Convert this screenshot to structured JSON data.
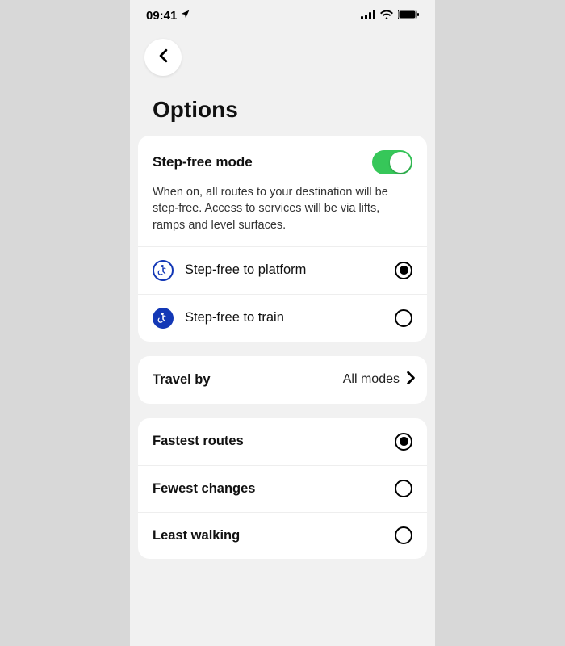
{
  "status": {
    "time": "09:41"
  },
  "page": {
    "title": "Options"
  },
  "stepfree": {
    "title": "Step-free mode",
    "description": "When on, all routes to your destination will be step-free. Access to services will be via lifts, ramps and level surfaces.",
    "options": [
      {
        "label": "Step-free to platform"
      },
      {
        "label": "Step-free to train"
      }
    ]
  },
  "travel": {
    "label": "Travel by",
    "value": "All modes"
  },
  "preferences": {
    "options": [
      {
        "label": "Fastest routes"
      },
      {
        "label": "Fewest changes"
      },
      {
        "label": "Least walking"
      }
    ]
  }
}
